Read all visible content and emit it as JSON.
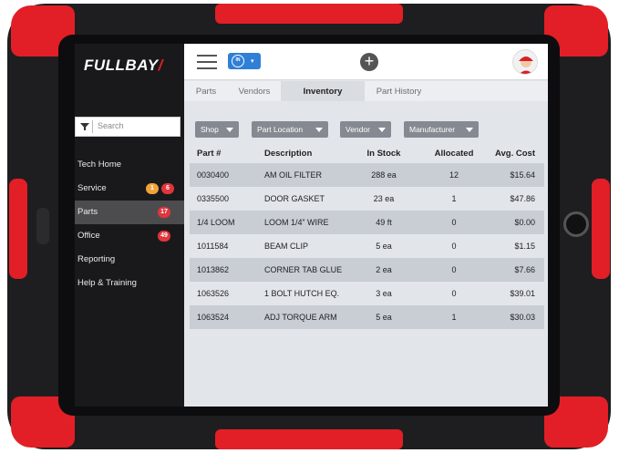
{
  "app": {
    "logo": "FULLBAY",
    "logo_mark": "/"
  },
  "sidebar": {
    "search_placeholder": "Search",
    "items": [
      {
        "label": "Tech Home"
      },
      {
        "label": "Service",
        "badges": [
          "1",
          "6"
        ]
      },
      {
        "label": "Parts",
        "badges": [
          "17"
        ]
      },
      {
        "label": "Office",
        "badges": [
          "49"
        ]
      },
      {
        "label": "Reporting"
      },
      {
        "label": "Help & Training"
      }
    ]
  },
  "topbar": {
    "clock_label": "IN",
    "add_icon": "+"
  },
  "tabs": [
    "Parts",
    "Vendors",
    "Inventory",
    "Part History"
  ],
  "filters": [
    "Shop",
    "Part Location",
    "Vendor",
    "Manufacturer"
  ],
  "table": {
    "headers": [
      "Part #",
      "Description",
      "In Stock",
      "Allocated",
      "Avg. Cost"
    ],
    "rows": [
      [
        "0030400",
        "AM OIL FILTER",
        "288 ea",
        "12",
        "$15.64"
      ],
      [
        "0335500",
        "DOOR GASKET",
        "23 ea",
        "1",
        "$47.86"
      ],
      [
        "1/4 LOOM",
        "LOOM 1/4” WIRE",
        "49 ft",
        "0",
        "$0.00"
      ],
      [
        "1011584",
        "BEAM CLIP",
        "5 ea",
        "0",
        "$1.15"
      ],
      [
        "1013862",
        "CORNER TAB GLUE",
        "2 ea",
        "0",
        "$7.66"
      ],
      [
        "1063526",
        "1 BOLT HUTCH EQ.",
        "3 ea",
        "0",
        "$39.01"
      ],
      [
        "1063524",
        "ADJ TORQUE ARM",
        "5 ea",
        "1",
        "$30.03"
      ]
    ]
  },
  "colors": {
    "brand_red": "#e21f26",
    "accent_blue": "#2f7fd6",
    "badge_orange": "#f0a23a",
    "badge_red": "#e0353c"
  }
}
